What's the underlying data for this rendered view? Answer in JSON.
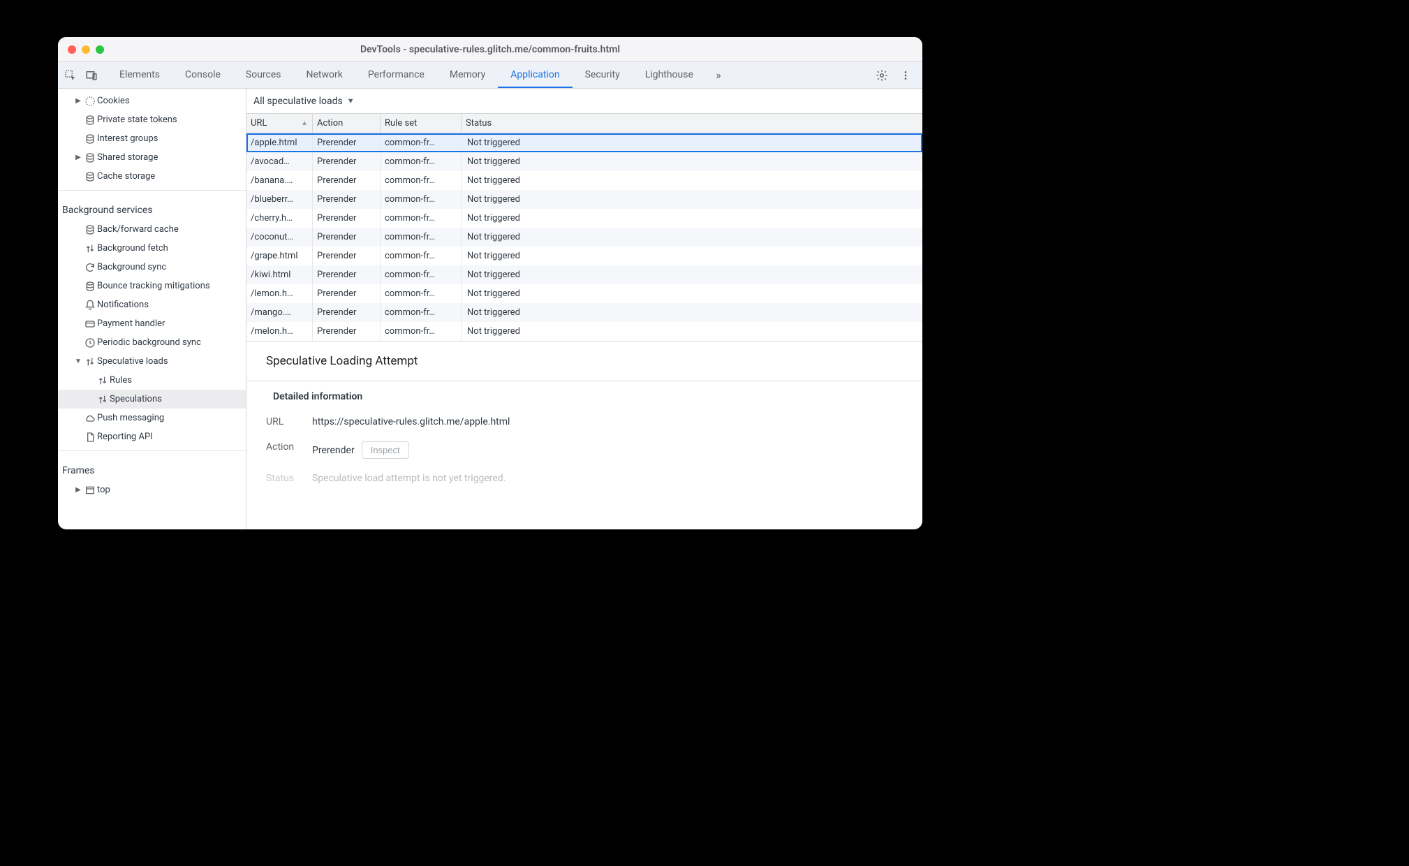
{
  "window": {
    "title": "DevTools - speculative-rules.glitch.me/common-fruits.html"
  },
  "tabs": {
    "items": [
      "Elements",
      "Console",
      "Sources",
      "Network",
      "Performance",
      "Memory",
      "Application",
      "Security",
      "Lighthouse"
    ],
    "active": "Application",
    "overflow_glyph": "»"
  },
  "sidebar": {
    "storage": [
      {
        "label": "Cookies",
        "icon": "cookie",
        "indent": 1,
        "arrow": "right"
      },
      {
        "label": "Private state tokens",
        "icon": "db",
        "indent": 1
      },
      {
        "label": "Interest groups",
        "icon": "db",
        "indent": 1
      },
      {
        "label": "Shared storage",
        "icon": "db",
        "indent": 1,
        "arrow": "right"
      },
      {
        "label": "Cache storage",
        "icon": "db",
        "indent": 1
      }
    ],
    "background_heading": "Background services",
    "background": [
      {
        "label": "Back/forward cache",
        "icon": "db",
        "indent": 1
      },
      {
        "label": "Background fetch",
        "icon": "updown",
        "indent": 1
      },
      {
        "label": "Background sync",
        "icon": "sync",
        "indent": 1
      },
      {
        "label": "Bounce tracking mitigations",
        "icon": "db",
        "indent": 1
      },
      {
        "label": "Notifications",
        "icon": "bell",
        "indent": 1
      },
      {
        "label": "Payment handler",
        "icon": "card",
        "indent": 1
      },
      {
        "label": "Periodic background sync",
        "icon": "clock",
        "indent": 1
      },
      {
        "label": "Speculative loads",
        "icon": "updown",
        "indent": 1,
        "arrow": "down"
      },
      {
        "label": "Rules",
        "icon": "updown",
        "indent": 2
      },
      {
        "label": "Speculations",
        "icon": "updown",
        "indent": 2,
        "selected": true
      },
      {
        "label": "Push messaging",
        "icon": "cloud",
        "indent": 1
      },
      {
        "label": "Reporting API",
        "icon": "doc",
        "indent": 1
      }
    ],
    "frames_heading": "Frames",
    "frames": [
      {
        "label": "top",
        "icon": "frame",
        "indent": 1,
        "arrow": "right"
      }
    ]
  },
  "filter": {
    "label": "All speculative loads"
  },
  "table": {
    "columns": [
      "URL",
      "Action",
      "Rule set",
      "Status"
    ],
    "sort_col": 0,
    "rows": [
      {
        "url": "/apple.html",
        "action": "Prerender",
        "ruleset": "common-fr…",
        "status": "Not triggered",
        "selected": true
      },
      {
        "url": "/avocad…",
        "action": "Prerender",
        "ruleset": "common-fr…",
        "status": "Not triggered"
      },
      {
        "url": "/banana.…",
        "action": "Prerender",
        "ruleset": "common-fr…",
        "status": "Not triggered"
      },
      {
        "url": "/blueberr…",
        "action": "Prerender",
        "ruleset": "common-fr…",
        "status": "Not triggered"
      },
      {
        "url": "/cherry.h…",
        "action": "Prerender",
        "ruleset": "common-fr…",
        "status": "Not triggered"
      },
      {
        "url": "/coconut…",
        "action": "Prerender",
        "ruleset": "common-fr…",
        "status": "Not triggered"
      },
      {
        "url": "/grape.html",
        "action": "Prerender",
        "ruleset": "common-fr…",
        "status": "Not triggered"
      },
      {
        "url": "/kiwi.html",
        "action": "Prerender",
        "ruleset": "common-fr…",
        "status": "Not triggered"
      },
      {
        "url": "/lemon.h…",
        "action": "Prerender",
        "ruleset": "common-fr…",
        "status": "Not triggered"
      },
      {
        "url": "/mango.…",
        "action": "Prerender",
        "ruleset": "common-fr…",
        "status": "Not triggered"
      },
      {
        "url": "/melon.h…",
        "action": "Prerender",
        "ruleset": "common-fr…",
        "status": "Not triggered"
      }
    ]
  },
  "detail": {
    "title": "Speculative Loading Attempt",
    "subheading": "Detailed information",
    "url_label": "URL",
    "url_value": "https://speculative-rules.glitch.me/apple.html",
    "action_label": "Action",
    "action_value": "Prerender",
    "inspect_label": "Inspect",
    "status_label": "Status",
    "status_value": "Speculative load attempt is not yet triggered."
  }
}
